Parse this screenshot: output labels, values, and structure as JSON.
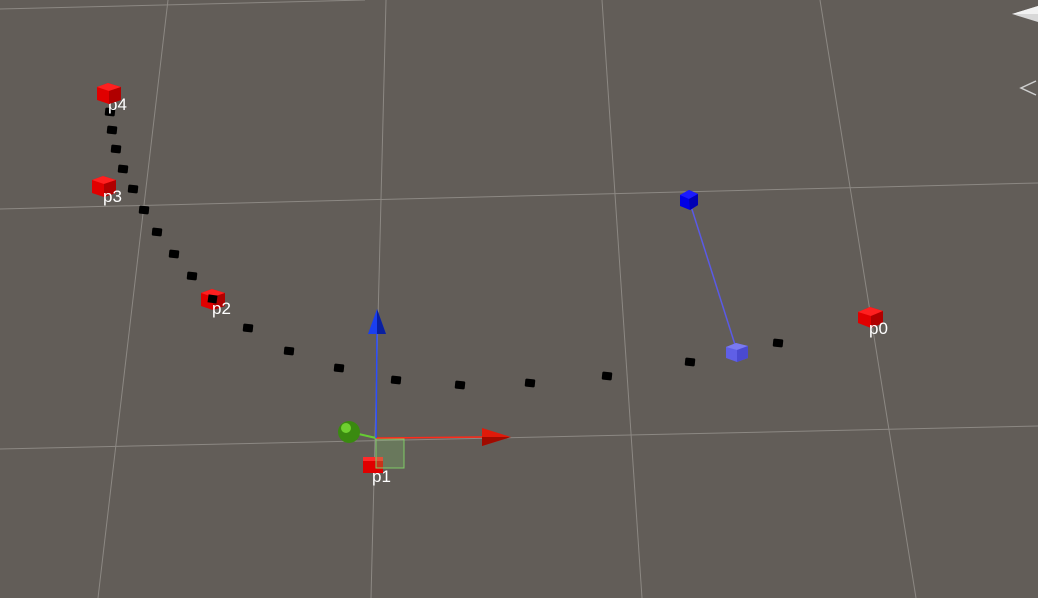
{
  "scene": {
    "background_color": "#625d58",
    "grid_color": "#8c8883"
  },
  "control_points": [
    {
      "label": "p0",
      "color": "#ff0000"
    },
    {
      "label": "p1",
      "color": "#ff0000"
    },
    {
      "label": "p2",
      "color": "#ff0000"
    },
    {
      "label": "p3",
      "color": "#ff0000"
    },
    {
      "label": "p4",
      "color": "#ff0000"
    }
  ],
  "path": {
    "sample_color": "#000000"
  },
  "tangent_handle": {
    "color": "#0000ff",
    "line_color": "#5a5ae6"
  },
  "move_gizmo": {
    "x_axis_color": "#ff2a1a",
    "y_axis_color": "#66cc33",
    "z_axis_color": "#2a4dff",
    "plane_handle_color": "#7fcc66"
  },
  "orientation_gizmo": {
    "icon": "view-orientation-gizmo"
  }
}
